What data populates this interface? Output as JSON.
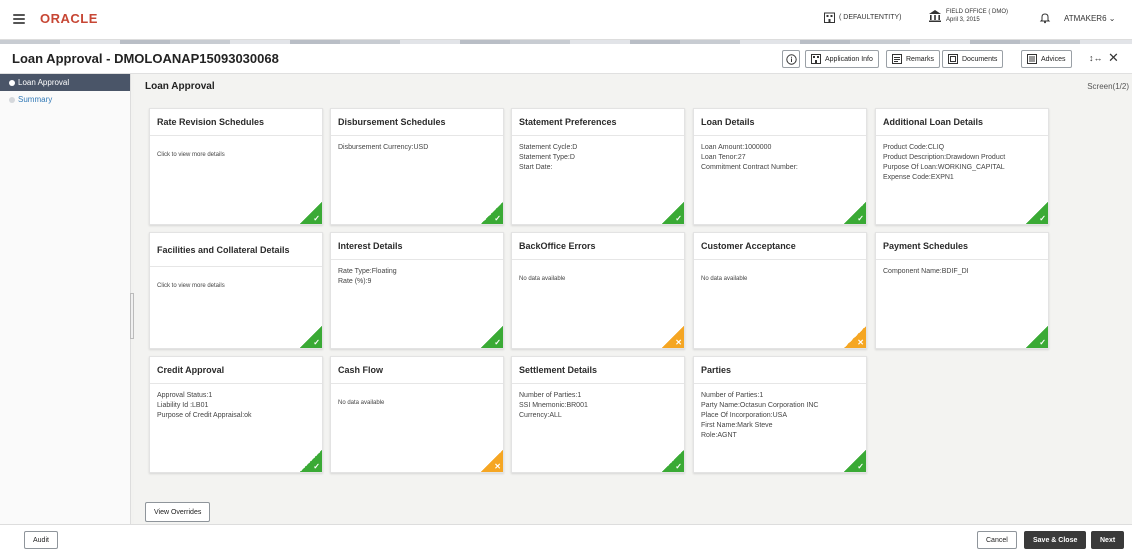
{
  "topbar": {
    "logo": "ORACLE",
    "entity": "( DEFAULTENTITY)",
    "branch_line1": "FIELD OFFICE ( DMO)",
    "branch_line2": "April 3, 2015",
    "user": "ATMAKER6"
  },
  "window": {
    "title": "Loan Approval - DMOLOANAP15093030068",
    "buttons": {
      "application_info": "Application Info",
      "remarks": "Remarks",
      "documents": "Documents",
      "advices": "Advices"
    }
  },
  "sidebar": {
    "items": [
      {
        "label": "Loan Approval",
        "active": true
      },
      {
        "label": "Summary",
        "active": false
      }
    ]
  },
  "main": {
    "title": "Loan Approval",
    "screen_indicator": "Screen(1/2)"
  },
  "cards": {
    "rate_revision": {
      "title": "Rate Revision Schedules",
      "lines": [
        "Click to view more details"
      ],
      "status": "ok"
    },
    "disbursement": {
      "title": "Disbursement Schedules",
      "lines": [
        "Disbursement Currency:USD"
      ],
      "status": "ok"
    },
    "statement_prefs": {
      "title": "Statement Preferences",
      "lines": [
        "Statement Cycle:D",
        "Statement Type:D",
        "Start Date:"
      ],
      "status": "ok"
    },
    "loan_details": {
      "title": "Loan Details",
      "lines": [
        "Loan Amount:1000000",
        "Loan Tenor:27",
        "Commitment Contract Number:"
      ],
      "status": "ok"
    },
    "additional_loan": {
      "title": "Additional Loan Details",
      "lines": [
        "Product Code:CLIQ",
        "Product Description:Drawdown Product",
        "Purpose Of Loan:WORKING_CAPITAL",
        "Expense Code:EXPN1"
      ],
      "status": "ok"
    },
    "facilities": {
      "title": "Facilities and Collateral Details",
      "lines": [
        "Click to view more details"
      ],
      "status": "ok"
    },
    "interest": {
      "title": "Interest Details",
      "lines": [
        "Rate Type:Floating",
        "Rate (%):9"
      ],
      "status": "ok"
    },
    "backoffice": {
      "title": "BackOffice Errors",
      "lines": [
        "No data available"
      ],
      "status": "warn"
    },
    "customer_acceptance": {
      "title": "Customer Acceptance",
      "lines": [
        "No data available"
      ],
      "status": "warn"
    },
    "payment_schedules": {
      "title": "Payment Schedules",
      "lines": [
        "Component Name:BDIF_DI"
      ],
      "status": "ok"
    },
    "credit_approval": {
      "title": "Credit Approval",
      "lines": [
        "Approval Status:1",
        "Liability Id :LB01",
        "Purpose of Credit Appraisal:ok"
      ],
      "status": "ok"
    },
    "cash_flow": {
      "title": "Cash Flow",
      "lines": [
        "No data available"
      ],
      "status": "warn"
    },
    "settlement": {
      "title": "Settlement Details",
      "lines": [
        "Number of Parties:1",
        "SSI Mnemonic:BR001",
        "Currency:ALL"
      ],
      "status": "ok"
    },
    "parties": {
      "title": "Parties",
      "lines": [
        "Number of Parties:1",
        "Party Name:Octasun Corporation INC",
        "Place Of Incorporation:USA",
        "First Name:Mark Steve",
        "Role:AGNT"
      ],
      "status": "ok"
    }
  },
  "view_overrides": "View Overrides",
  "footer": {
    "audit": "Audit",
    "cancel": "Cancel",
    "save_close": "Save & Close",
    "next": "Next"
  },
  "colors": {
    "brand": "#c74634",
    "ok": "#3aaa35",
    "warn": "#f5a623",
    "sidebar_active": "#4a5568"
  }
}
